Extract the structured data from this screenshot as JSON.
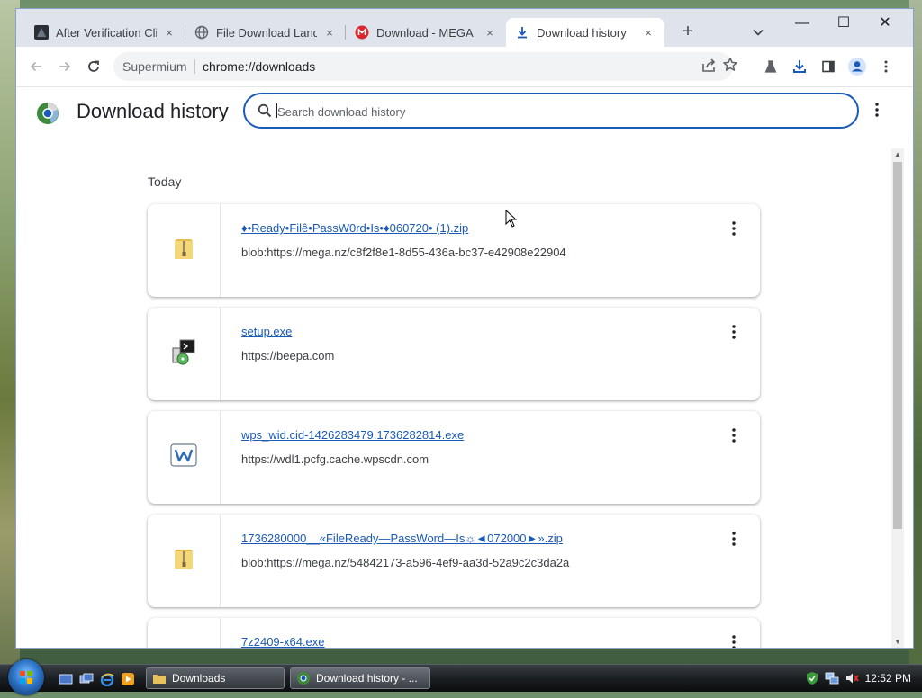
{
  "window": {
    "tabs": [
      {
        "title": "After Verification Cli",
        "close": "×"
      },
      {
        "title": "File Download Landi",
        "close": "×"
      },
      {
        "title": "Download - MEGA",
        "close": "×"
      },
      {
        "title": "Download history",
        "close": "×"
      }
    ],
    "new_tab": "+",
    "controls": {
      "minimize": "—",
      "maximize": "☐",
      "close": "✕"
    }
  },
  "toolbar": {
    "site_chip": "Supermium",
    "url": "chrome://downloads"
  },
  "page": {
    "title": "Download history",
    "search_placeholder": "Search download history",
    "day_label": "Today",
    "downloads": [
      {
        "name": "♦•Ready•Filê•PassW0rd•Is•♦060720• (1).zip",
        "url": "blob:https://mega.nz/c8f2f8e1-8d55-436a-bc37-e42908e22904",
        "icon": "folder-zip-icon"
      },
      {
        "name": "setup.exe",
        "url": "https://beepa.com",
        "icon": "installer-icon"
      },
      {
        "name": "wps_wid.cid-1426283479.1736282814.exe",
        "url": "https://wdl1.pcfg.cache.wpscdn.com",
        "icon": "wps-office-icon"
      },
      {
        "name": "1736280000__«FileReady—PassWord—Is☼◄072000►».zip",
        "url": "blob:https://mega.nz/54842173-a596-4ef9-aa3d-52a9c2c3da2a",
        "icon": "folder-zip-icon"
      },
      {
        "name": "7z2409-x64.exe",
        "url": "",
        "icon": "app-icon"
      }
    ]
  },
  "taskbar": {
    "buttons": [
      {
        "label": "Downloads"
      },
      {
        "label": "Download history - ..."
      }
    ],
    "clock": "12:52 PM"
  },
  "colors": {
    "accent": "#1a5ab8",
    "tabstrip": "#dee3ec"
  }
}
